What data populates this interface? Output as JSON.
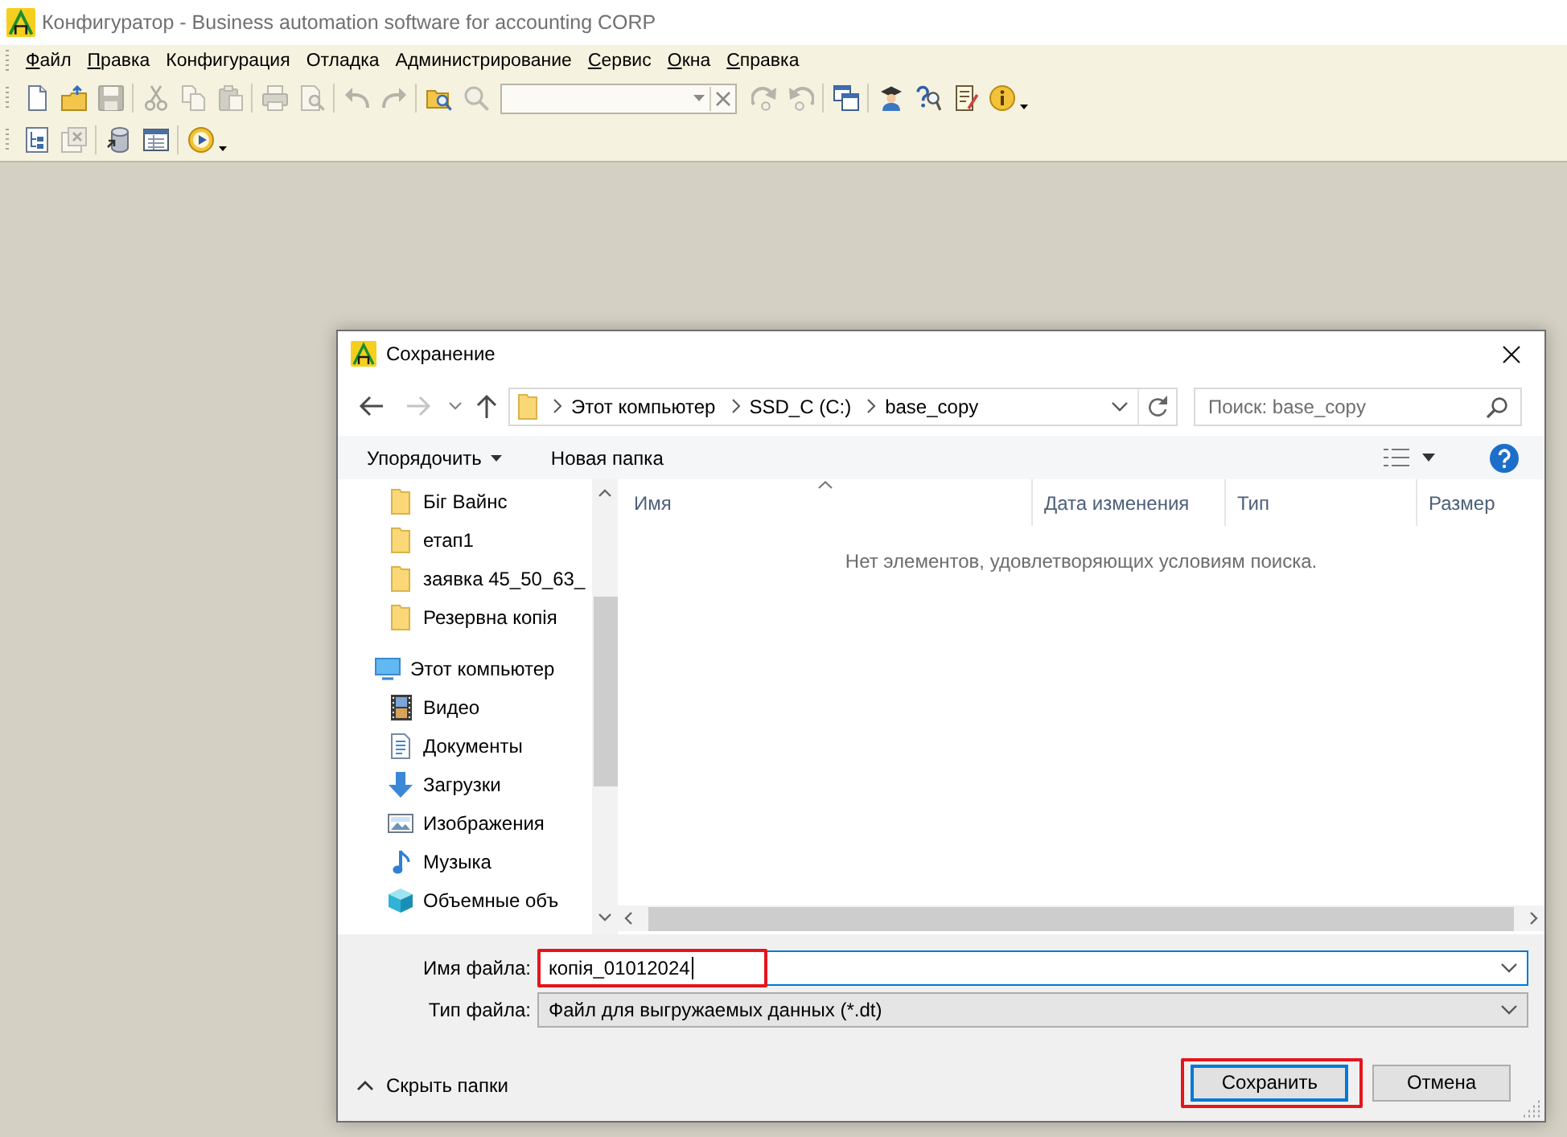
{
  "window": {
    "title": "Конфигуратор - Business automation software for accounting CORP"
  },
  "menu": [
    {
      "label": "Файл",
      "underline_first": true
    },
    {
      "label": "Правка",
      "underline_first": true
    },
    {
      "label": "Конфигурация",
      "underline_first": false
    },
    {
      "label": "Отладка",
      "underline_first": false
    },
    {
      "label": "Администрирование",
      "underline_first": false
    },
    {
      "label": "Сервис",
      "underline_first": true
    },
    {
      "label": "Окна",
      "underline_first": true
    },
    {
      "label": "Справка",
      "underline_first": true
    }
  ],
  "toolbars": [
    [
      {
        "kind": "new",
        "disabled": false
      },
      {
        "kind": "open",
        "disabled": false
      },
      {
        "kind": "save",
        "disabled": true
      },
      {
        "kind": "separator"
      },
      {
        "kind": "cut",
        "disabled": true
      },
      {
        "kind": "copy",
        "disabled": true
      },
      {
        "kind": "paste",
        "disabled": true
      },
      {
        "kind": "separator"
      },
      {
        "kind": "print",
        "disabled": true
      },
      {
        "kind": "preview",
        "disabled": true
      },
      {
        "kind": "separator"
      },
      {
        "kind": "undo",
        "disabled": true
      },
      {
        "kind": "redo",
        "disabled": true
      },
      {
        "kind": "separator"
      },
      {
        "kind": "findfolder",
        "disabled": false
      },
      {
        "kind": "search",
        "disabled": true
      },
      {
        "kind": "searchcombo"
      },
      {
        "kind": "findnext",
        "disabled": true
      },
      {
        "kind": "findprev",
        "disabled": true
      },
      {
        "kind": "separator"
      },
      {
        "kind": "windows",
        "disabled": false
      },
      {
        "kind": "separator"
      },
      {
        "kind": "wizard",
        "disabled": false
      },
      {
        "kind": "helpsearch",
        "disabled": false
      },
      {
        "kind": "notepad",
        "disabled": false
      },
      {
        "kind": "info",
        "disabled": false
      },
      {
        "kind": "caret",
        "disabled": false
      }
    ],
    [
      {
        "kind": "tree",
        "disabled": false
      },
      {
        "kind": "windowclose",
        "disabled": true
      },
      {
        "kind": "separator"
      },
      {
        "kind": "database",
        "disabled": false
      },
      {
        "kind": "form",
        "disabled": false
      },
      {
        "kind": "separator"
      },
      {
        "kind": "play",
        "disabled": false
      },
      {
        "kind": "caret",
        "disabled": false
      }
    ]
  ],
  "dialog": {
    "title": "Сохранение",
    "nav_buttons": [
      {
        "kind": "back",
        "disabled": false
      },
      {
        "kind": "forward",
        "disabled": true
      },
      {
        "kind": "recent",
        "disabled": false
      },
      {
        "kind": "up",
        "disabled": false
      }
    ],
    "breadcrumb": [
      "Этот компьютер",
      "SSD_C (C:)",
      "base_copy"
    ],
    "search": {
      "placeholder": "Поиск: base_copy"
    },
    "commands": [
      {
        "label": "Упорядочить",
        "dropdown": true
      },
      {
        "label": "Новая папка",
        "dropdown": false
      }
    ],
    "folders": [
      {
        "label": "Біг Вайнс"
      },
      {
        "label": "етап1"
      },
      {
        "label": "заявка 45_50_63_"
      },
      {
        "label": "Резервна копія"
      }
    ],
    "tree": [
      {
        "label": "Этот компьютер",
        "kind": "computer",
        "children": [
          {
            "label": "Видео",
            "kind": "videos"
          },
          {
            "label": "Документы",
            "kind": "documents"
          },
          {
            "label": "Загрузки",
            "kind": "downloads"
          },
          {
            "label": "Изображения",
            "kind": "pictures"
          },
          {
            "label": "Музыка",
            "kind": "music"
          },
          {
            "label": "Объемные объ",
            "kind": "objects3d"
          }
        ]
      }
    ],
    "columns": [
      {
        "label": "Имя",
        "sorted": true
      },
      {
        "label": "Дата изменения",
        "sorted": false
      },
      {
        "label": "Тип",
        "sorted": false
      },
      {
        "label": "Размер",
        "sorted": false
      }
    ],
    "empty_message": "Нет элементов, удовлетворяющих условиям поиска.",
    "filename": {
      "label": "Имя файла:",
      "value": "копія_01012024",
      "focused": true,
      "highlighted": true
    },
    "filetype": {
      "label": "Тип файла:",
      "value": "Файл для выгружаемых данных (*.dt)"
    },
    "folders_toggle": {
      "label": "Скрыть папки"
    },
    "buttons": [
      {
        "label": "Сохранить",
        "default": true,
        "highlighted": true
      },
      {
        "label": "Отмена",
        "default": false,
        "highlighted": false
      }
    ]
  }
}
